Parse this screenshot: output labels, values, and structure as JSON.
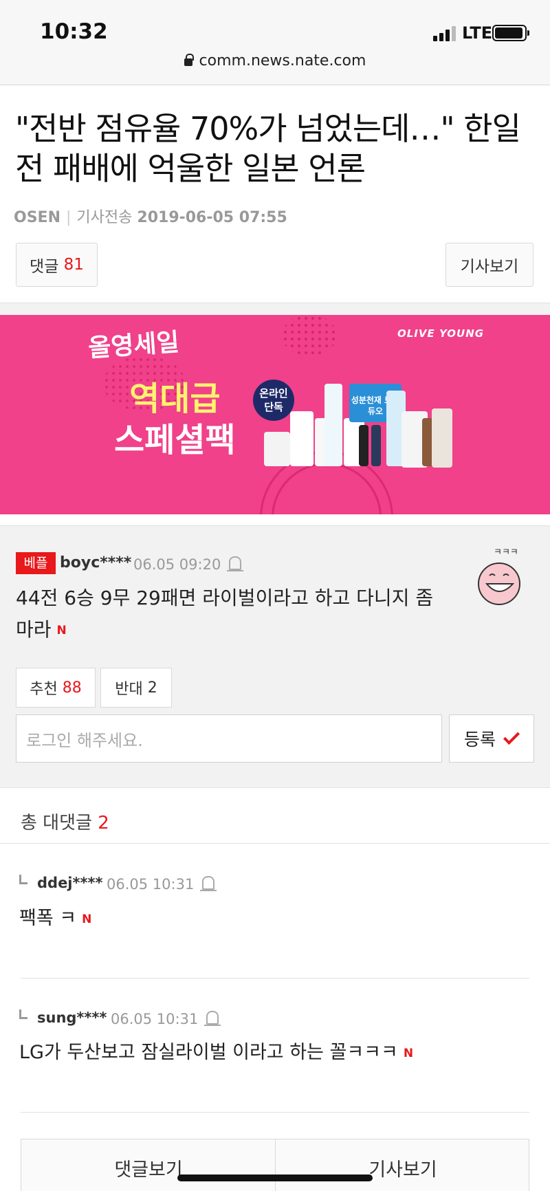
{
  "status_bar": {
    "time": "10:32",
    "network": "LTE",
    "url": "comm.news.nate.com"
  },
  "article": {
    "headline": "\"전반 점유율 70%가 넘었는데…\" 한일전 패배에 억울한 일본 언론",
    "source": "OSEN",
    "sent_label": "기사전송",
    "datetime": "2019-06-05 07:55",
    "comments_label": "댓글",
    "comments_count": "81",
    "view_article_label": "기사보기"
  },
  "banner": {
    "logo_text": "올영세일",
    "brand": "OLIVE YOUNG",
    "title_line1": "역대급",
    "title_line2": "스페셜팩",
    "badge_text": "온라인 단독",
    "product_text": "성분천재 보습듀오"
  },
  "best_comment": {
    "badge": "베플",
    "user": "boyc****",
    "date": "06.05 09:20",
    "text": "44전 6승 9무 29패면 라이벌이라고 하고 다니지 좀 마라",
    "new_mark": "N",
    "recommend_label": "추천",
    "recommend_count": "88",
    "oppose_label": "반대",
    "oppose_count": "2",
    "input_placeholder": "로그인 해주세요.",
    "submit_label": "등록"
  },
  "replies": {
    "total_label": "총 대댓글",
    "total_count": "2",
    "items": [
      {
        "user": "ddej****",
        "date": "06.05 10:31",
        "text": "팩폭 ㅋ",
        "new_mark": "N"
      },
      {
        "user": "sung****",
        "date": "06.05 10:31",
        "text": "LG가 두산보고 잠실라이벌 이라고 하는 꼴ㅋㅋㅋ",
        "new_mark": "N"
      }
    ]
  },
  "bottom_nav": {
    "comments_view": "댓글보기",
    "article_view": "기사보기"
  },
  "colors": {
    "accent_red": "#e8181b",
    "banner_pink": "#f0418a"
  }
}
